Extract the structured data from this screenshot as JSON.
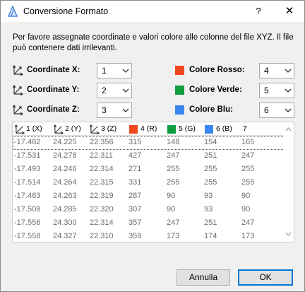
{
  "window": {
    "title": "Conversione Formato",
    "help_label": "?",
    "close_label": "✕"
  },
  "description": "Per favore assegnate coordinate e valori colore alle colonne del file XYZ. Il file può contenere dati irrilevanti.",
  "coordinates": [
    {
      "label": "Coordinate X:",
      "value": "1",
      "icon": "axis-x-icon"
    },
    {
      "label": "Coordinate Y:",
      "value": "2",
      "icon": "axis-y-icon"
    },
    {
      "label": "Coordinate Z:",
      "value": "3",
      "icon": "axis-z-icon"
    }
  ],
  "colors": [
    {
      "label": "Colore Rosso:",
      "value": "4",
      "swatch": "#f2461e"
    },
    {
      "label": "Colore Verde:",
      "value": "5",
      "swatch": "#0f9d3f"
    },
    {
      "label": "Colore Blu:",
      "value": "6",
      "swatch": "#3a86f0"
    }
  ],
  "table": {
    "headers": [
      "1 (X)",
      "2 (Y)",
      "3 (Z)",
      "4 (R)",
      "5 (G)",
      "6 (B)",
      "7"
    ],
    "rows": [
      [
        "-17.482",
        "24.225",
        "22.356",
        "315",
        "148",
        "154",
        "165"
      ],
      [
        "-17.531",
        "24.278",
        "22.311",
        "427",
        "247",
        "251",
        "247"
      ],
      [
        "-17.493",
        "24.246",
        "22.314",
        "271",
        "255",
        "255",
        "255"
      ],
      [
        "-17.514",
        "24.264",
        "22.315",
        "331",
        "255",
        "255",
        "255"
      ],
      [
        "-17.483",
        "24.263",
        "22.319",
        "287",
        "90",
        "93",
        "90"
      ],
      [
        "-17.508",
        "24.285",
        "22.320",
        "307",
        "90",
        "93",
        "90"
      ],
      [
        "-17.556",
        "24.300",
        "22.314",
        "357",
        "247",
        "251",
        "247"
      ],
      [
        "-17.558",
        "24.327",
        "22.310",
        "359",
        "173",
        "174",
        "173"
      ]
    ]
  },
  "buttons": {
    "cancel": "Annulla",
    "ok": "OK"
  }
}
